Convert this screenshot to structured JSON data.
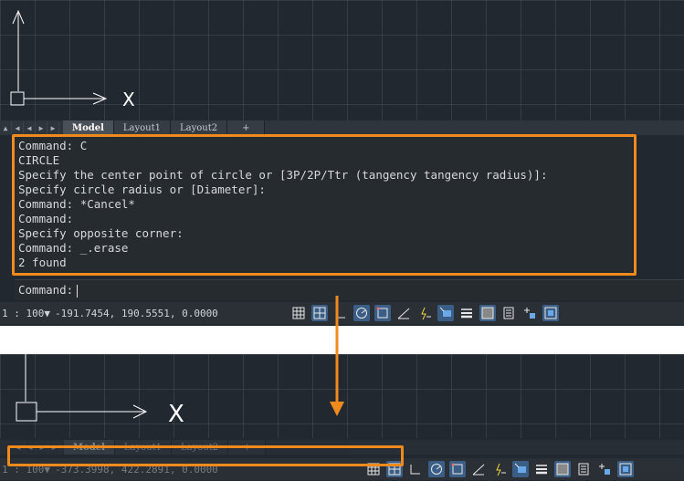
{
  "colors": {
    "canvas": "#212830",
    "highlight": "#f08a1c",
    "toggle_on": "#3b5e86"
  },
  "axis_label": "X",
  "tabs": [
    "Model",
    "Layout1",
    "Layout2",
    "+"
  ],
  "history": [
    "Command: C",
    "CIRCLE",
    "Specify the center point of circle or [3P/2P/Ttr (tangency tangency radius)]:",
    "Specify circle radius or [Diameter]:",
    "Command: *Cancel*",
    "Command:",
    "Specify opposite corner:",
    "Command: _.erase",
    "2 found"
  ],
  "prompt": "Command:",
  "status": {
    "scale": "1 : 100",
    "coords": "-191.7454, 190.5551, 0.0000",
    "scale2": "1 : 100",
    "coords2": "-373.3998, 422.2891, 0.0000"
  },
  "toggles": [
    {
      "name": "grid-display-icon",
      "on": false
    },
    {
      "name": "snap-mode-icon",
      "on": true
    },
    {
      "name": "ortho-icon",
      "on": false
    },
    {
      "name": "polar-tracking-icon",
      "on": true
    },
    {
      "name": "object-snap-icon",
      "on": true
    },
    {
      "name": "object-tracking-icon",
      "on": false
    },
    {
      "name": "dynamic-ucs-icon",
      "on": false
    },
    {
      "name": "dynamic-input-icon",
      "on": true
    },
    {
      "name": "lineweight-icon",
      "on": false
    },
    {
      "name": "transparency-icon",
      "on": true
    },
    {
      "name": "quick-properties-icon",
      "on": false
    },
    {
      "name": "selection-cycling-icon",
      "on": false
    },
    {
      "name": "annotation-monitor-icon",
      "on": true
    }
  ]
}
